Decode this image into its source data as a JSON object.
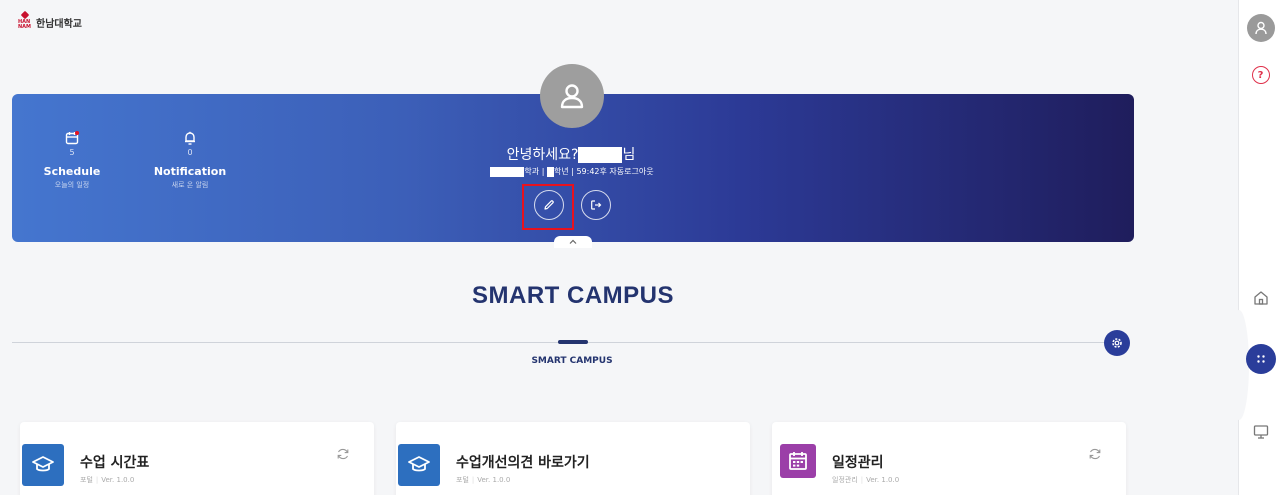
{
  "logo": {
    "mark": "HAN NAM",
    "text": "한남대학교"
  },
  "hero": {
    "schedule": {
      "count": "5",
      "title": "Schedule",
      "subtitle": "오늘의 일정"
    },
    "notification": {
      "count": "0",
      "title": "Notification",
      "subtitle": "새로 온 알림"
    },
    "greeting_prefix": "안녕하세요?",
    "greeting_suffix": "님",
    "info_dept_suffix": "학과",
    "info_year_suffix": "학년",
    "info_separator": "|",
    "auto_logout": "59:42후 자동로그아웃"
  },
  "section": {
    "title": "SMART CAMPUS",
    "subtitle": "SMART CAMPUS"
  },
  "cards": [
    {
      "title": "수업 시간표",
      "category": "포털",
      "version": "Ver. 1.0.0",
      "color": "#2d6fbf"
    },
    {
      "title": "수업개선의견 바로가기",
      "category": "포털",
      "version": "Ver. 1.0.0",
      "color": "#2d6fbf"
    },
    {
      "title": "일정관리",
      "category": "일정관리",
      "version": "Ver. 1.0.0",
      "color": "#9b3fa8"
    }
  ],
  "icons": {
    "user": "user-icon",
    "help": "help-icon",
    "home": "home-icon",
    "apps": "apps-grid-icon",
    "monitor": "monitor-icon",
    "calendar": "calendar-icon",
    "bell": "bell-icon",
    "edit": "pencil-icon",
    "logout": "logout-icon",
    "chevron": "chevron-up-icon",
    "settings": "gear-icon",
    "graduation": "graduation-cap-icon",
    "refresh": "refresh-icon"
  },
  "colors": {
    "brand": "#24346f",
    "accent": "#2a3d9a",
    "highlight": "#e8121e",
    "help": "#e0314b"
  }
}
